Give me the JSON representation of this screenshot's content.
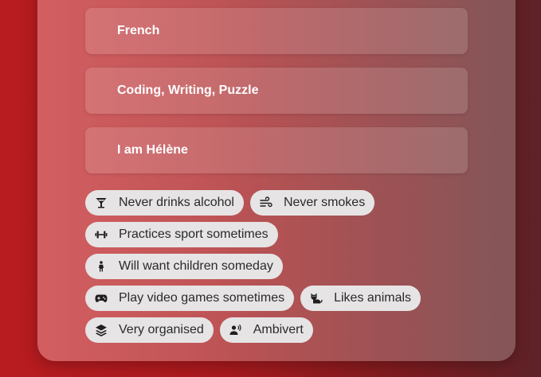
{
  "fields": [
    {
      "value": "French"
    },
    {
      "value": "Coding, Writing, Puzzle"
    },
    {
      "value": "I am Hélène"
    }
  ],
  "chips": [
    {
      "label": "Never drinks alcohol",
      "icon": "cocktail-glass-icon"
    },
    {
      "label": "Never smokes",
      "icon": "wind-icon"
    },
    {
      "label": "Practices sport sometimes",
      "icon": "dumbbell-icon"
    },
    {
      "label": "Will want children someday",
      "icon": "child-icon"
    },
    {
      "label": "Play video games sometimes",
      "icon": "gamepad-icon"
    },
    {
      "label": "Likes animals",
      "icon": "cat-icon"
    },
    {
      "label": "Very organised",
      "icon": "layers-icon"
    },
    {
      "label": "Ambivert",
      "icon": "person-speaking-icon"
    }
  ]
}
